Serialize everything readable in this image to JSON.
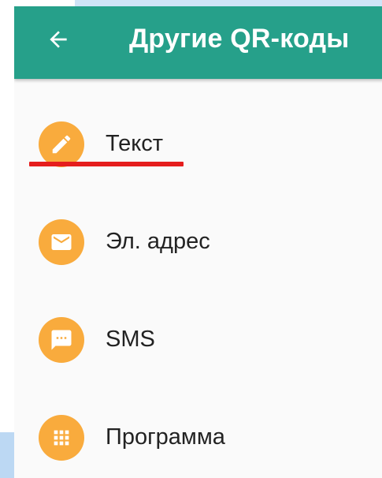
{
  "toolbar": {
    "title": "Другие QR-коды",
    "back_icon": "arrow-back-icon",
    "background_color": "#26a08a"
  },
  "list": {
    "icon_color": "#f9ab3d",
    "items": [
      {
        "label": "Текст",
        "icon": "pencil-icon"
      },
      {
        "label": "Эл. адрес",
        "icon": "envelope-icon"
      },
      {
        "label": "SMS",
        "icon": "message-icon"
      },
      {
        "label": "Программа",
        "icon": "apps-grid-icon"
      }
    ]
  },
  "annotation": {
    "underline_color": "#e51d1d"
  }
}
